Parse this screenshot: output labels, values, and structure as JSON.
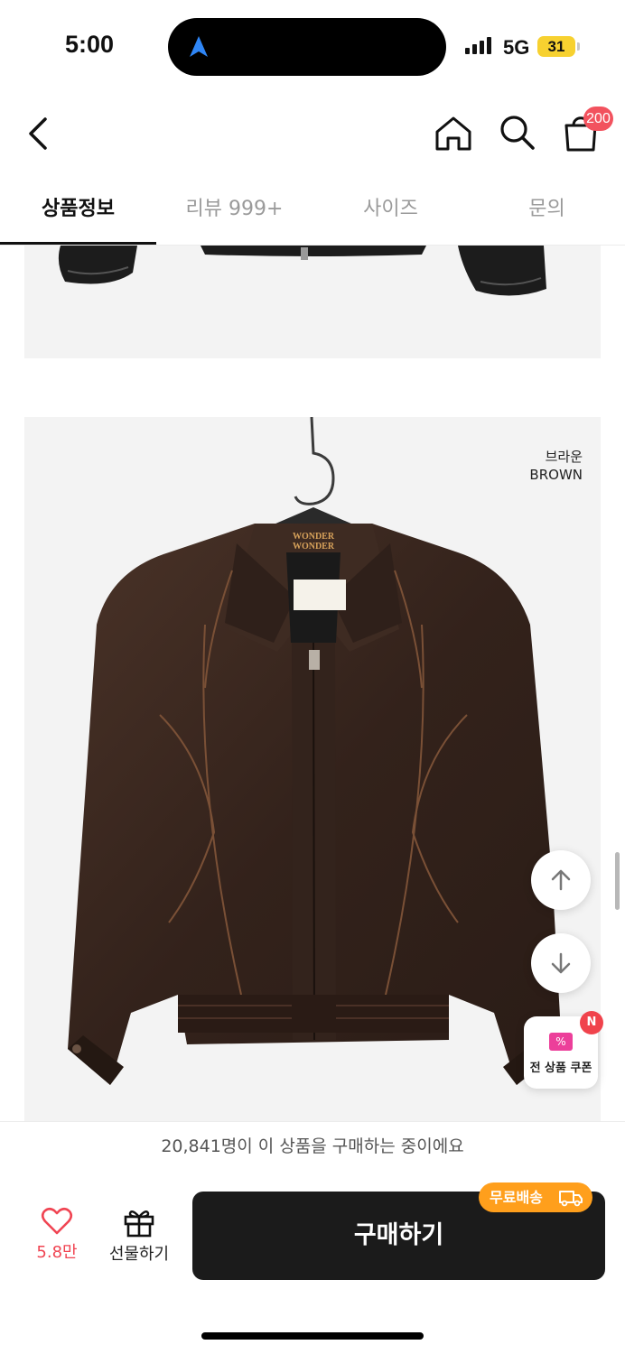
{
  "status_bar": {
    "time": "5:00",
    "network": "5G",
    "battery": "31"
  },
  "header": {
    "cart_count": "200"
  },
  "tabs": [
    {
      "label": "상품정보",
      "active": true
    },
    {
      "label": "리뷰 999+",
      "active": false
    },
    {
      "label": "사이즈",
      "active": false
    },
    {
      "label": "문의",
      "active": false
    }
  ],
  "product_image": {
    "color_ko": "브라운",
    "color_en": "BROWN",
    "tag_brand": "WONDER WONDER"
  },
  "floating": {
    "coupon_label": "전 상품 쿠폰",
    "coupon_badge": "N"
  },
  "purchase_notice": "20,841명이 이 상품을 구매하는 중이에요",
  "bottom_bar": {
    "like_count": "5.8만",
    "gift_label": "선물하기",
    "buy_label": "구매하기",
    "free_shipping": "무료배송"
  },
  "colors": {
    "accent_red": "#f04452",
    "shipping_orange": "#ff9f1c",
    "buy_button": "#1b1b1b",
    "jacket_brown": "#3b2820"
  }
}
